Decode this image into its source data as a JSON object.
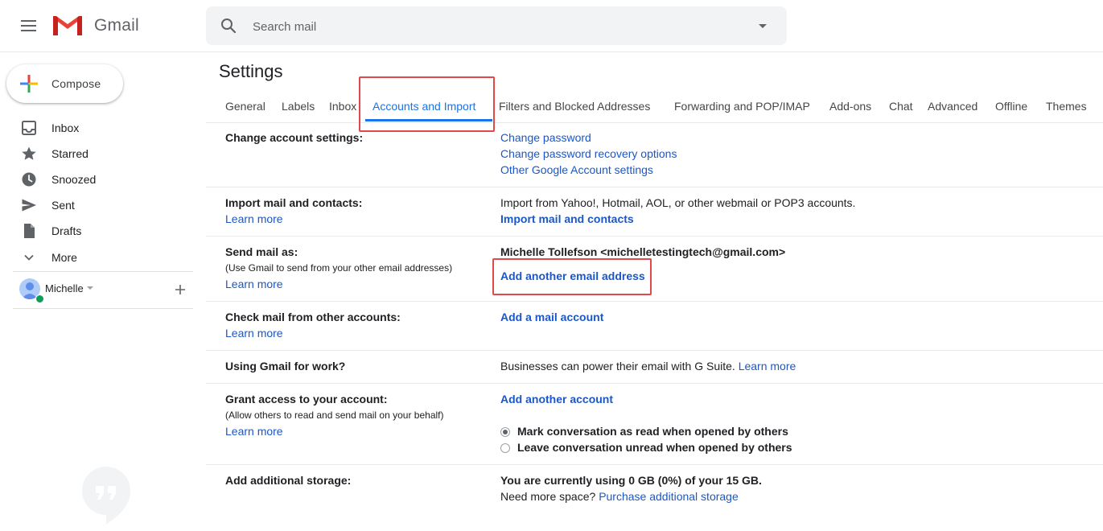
{
  "header": {
    "app_name": "Gmail",
    "search_placeholder": "Search mail"
  },
  "sidebar": {
    "compose_label": "Compose",
    "items": [
      {
        "label": "Inbox",
        "icon": "inbox-icon"
      },
      {
        "label": "Starred",
        "icon": "star-icon"
      },
      {
        "label": "Snoozed",
        "icon": "clock-icon"
      },
      {
        "label": "Sent",
        "icon": "send-icon"
      },
      {
        "label": "Drafts",
        "icon": "draft-icon"
      },
      {
        "label": "More",
        "icon": "chevron-down-icon"
      }
    ],
    "user_name": "Michelle"
  },
  "main": {
    "title": "Settings",
    "tabs": [
      "General",
      "Labels",
      "Inbox",
      "Accounts and Import",
      "Filters and Blocked Addresses",
      "Forwarding and POP/IMAP",
      "Add-ons",
      "Chat",
      "Advanced",
      "Offline",
      "Themes"
    ],
    "active_tab": "Accounts and Import",
    "rows": {
      "change_account": {
        "label": "Change account settings:",
        "links": [
          "Change password",
          "Change password recovery options",
          "Other Google Account settings"
        ]
      },
      "import": {
        "label": "Import mail and contacts:",
        "learn_more": "Learn more",
        "text": "Import from Yahoo!, Hotmail, AOL, or other webmail or POP3 accounts.",
        "action": "Import mail and contacts"
      },
      "send_as": {
        "label": "Send mail as:",
        "sub": "(Use Gmail to send from your other email addresses)",
        "learn_more": "Learn more",
        "address": "Michelle Tollefson <michelletestingtech@gmail.com>",
        "action": "Add another email address"
      },
      "check_mail": {
        "label": "Check mail from other accounts:",
        "learn_more": "Learn more",
        "action": "Add a mail account"
      },
      "work": {
        "label": "Using Gmail for work?",
        "text": "Businesses can power their email with G Suite.",
        "link": "Learn more"
      },
      "grant": {
        "label": "Grant access to your account:",
        "sub": "(Allow others to read and send mail on your behalf)",
        "learn_more": "Learn more",
        "action": "Add another account",
        "options": [
          {
            "label": "Mark conversation as read when opened by others",
            "checked": true
          },
          {
            "label": "Leave conversation unread when opened by others",
            "checked": false
          }
        ]
      },
      "storage": {
        "label": "Add additional storage:",
        "usage": "You are currently using 0 GB (0%) of your 15 GB.",
        "need_more": "Need more space?",
        "link": "Purchase additional storage"
      }
    }
  },
  "colors": {
    "accent": "#1a73e8",
    "link": "#1a57c8",
    "highlight_box": "#e0484a",
    "gmail_red": "#ea4335"
  }
}
